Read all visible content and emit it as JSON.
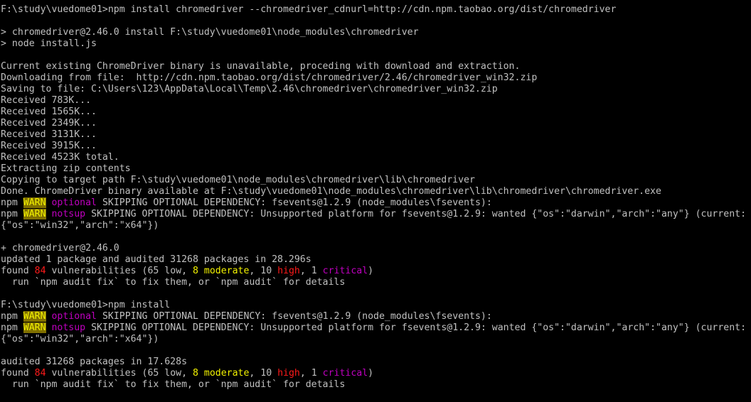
{
  "terminal": {
    "colors": {
      "background": "#000000",
      "default": "#c0c0c0",
      "warn": "#f2f200",
      "warn_background": "#807000",
      "magenta": "#c000c0",
      "red": "#ff1a1a",
      "yellow": "#f2f200",
      "green": "#13c010"
    },
    "lines": [
      [
        {
          "t": "F:\\study\\vuedome01>npm install chromedriver --chromedriver_cdnurl=http://cdn.npm.taobao.org/dist/chromedriver"
        }
      ],
      [],
      [
        {
          "t": "> chromedriver@2.46.0 install F:\\study\\vuedome01\\node_modules\\chromedriver"
        }
      ],
      [
        {
          "t": "> node install.js"
        }
      ],
      [],
      [
        {
          "t": "Current existing ChromeDriver binary is unavailable, proceding with download and extraction."
        }
      ],
      [
        {
          "t": "Downloading from file:  http://cdn.npm.taobao.org/dist/chromedriver/2.46/chromedriver_win32.zip"
        }
      ],
      [
        {
          "t": "Saving to file: C:\\Users\\123\\AppData\\Local\\Temp\\2.46\\chromedriver\\chromedriver_win32.zip"
        }
      ],
      [
        {
          "t": "Received 783K..."
        }
      ],
      [
        {
          "t": "Received 1565K..."
        }
      ],
      [
        {
          "t": "Received 2349K..."
        }
      ],
      [
        {
          "t": "Received 3131K..."
        }
      ],
      [
        {
          "t": "Received 3915K..."
        }
      ],
      [
        {
          "t": "Received 4523K total."
        }
      ],
      [
        {
          "t": "Extracting zip contents"
        }
      ],
      [
        {
          "t": "Copying to target path F:\\study\\vuedome01\\node_modules\\chromedriver\\lib\\chromedriver"
        }
      ],
      [
        {
          "t": "Done. ChromeDriver binary available at F:\\study\\vuedome01\\node_modules\\chromedriver\\lib\\chromedriver\\chromedriver.exe"
        }
      ],
      [
        {
          "t": "npm "
        },
        {
          "t": "WARN",
          "c": "warn"
        },
        {
          "t": " "
        },
        {
          "t": "optional",
          "c": "magenta"
        },
        {
          "t": " SKIPPING OPTIONAL DEPENDENCY: fsevents@1.2.9 (node_modules\\fsevents):"
        }
      ],
      [
        {
          "t": "npm "
        },
        {
          "t": "WARN",
          "c": "warn"
        },
        {
          "t": " "
        },
        {
          "t": "notsup",
          "c": "magenta"
        },
        {
          "t": " SKIPPING OPTIONAL DEPENDENCY: Unsupported platform for fsevents@1.2.9: wanted {\"os\":\"darwin\",\"arch\":\"any\"} (current:"
        }
      ],
      [
        {
          "t": "{\"os\":\"win32\",\"arch\":\"x64\"})"
        }
      ],
      [],
      [
        {
          "t": "+ chromedriver@2.46.0"
        }
      ],
      [
        {
          "t": "updated 1 package and audited 31268 packages in 28.296s"
        }
      ],
      [
        {
          "t": "found "
        },
        {
          "t": "84",
          "c": "red"
        },
        {
          "t": " vulnerabilities (65 low, "
        },
        {
          "t": "8",
          "c": "yellow"
        },
        {
          "t": " "
        },
        {
          "t": "moderate",
          "c": "yellow"
        },
        {
          "t": ", 10 "
        },
        {
          "t": "high",
          "c": "red"
        },
        {
          "t": ", 1 "
        },
        {
          "t": "critical",
          "c": "magenta"
        },
        {
          "t": ")"
        }
      ],
      [
        {
          "t": "  run `npm audit fix` to fix them, or `npm audit` for details"
        }
      ],
      [],
      [
        {
          "t": "F:\\study\\vuedome01>npm install"
        }
      ],
      [
        {
          "t": "npm "
        },
        {
          "t": "WARN",
          "c": "warn"
        },
        {
          "t": " "
        },
        {
          "t": "optional",
          "c": "magenta"
        },
        {
          "t": " SKIPPING OPTIONAL DEPENDENCY: fsevents@1.2.9 (node_modules\\fsevents):"
        }
      ],
      [
        {
          "t": "npm "
        },
        {
          "t": "WARN",
          "c": "warn"
        },
        {
          "t": " "
        },
        {
          "t": "notsup",
          "c": "magenta"
        },
        {
          "t": " SKIPPING OPTIONAL DEPENDENCY: Unsupported platform for fsevents@1.2.9: wanted {\"os\":\"darwin\",\"arch\":\"any\"} (current:"
        }
      ],
      [
        {
          "t": "{\"os\":\"win32\",\"arch\":\"x64\"})"
        }
      ],
      [],
      [
        {
          "t": "audited 31268 packages in 17.628s"
        }
      ],
      [
        {
          "t": "found "
        },
        {
          "t": "84",
          "c": "red"
        },
        {
          "t": " vulnerabilities (65 low, "
        },
        {
          "t": "8",
          "c": "yellow"
        },
        {
          "t": " "
        },
        {
          "t": "moderate",
          "c": "yellow"
        },
        {
          "t": ", 10 "
        },
        {
          "t": "high",
          "c": "red"
        },
        {
          "t": ", 1 "
        },
        {
          "t": "critical",
          "c": "magenta"
        },
        {
          "t": ")"
        }
      ],
      [
        {
          "t": "  run `npm audit fix` to fix them, or `npm audit` for details"
        }
      ]
    ]
  }
}
